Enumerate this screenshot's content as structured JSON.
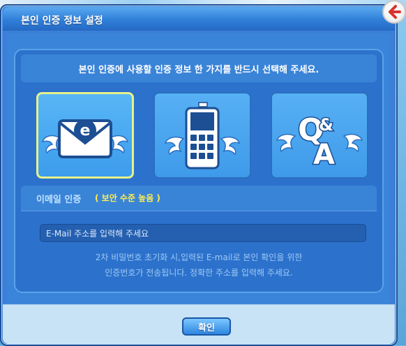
{
  "dialog": {
    "title": "본인 인증 정보 설정",
    "header_text": "본인 인증에 사용할 인증 정보 한 가지를 반드시 선택해 주세요.",
    "options": [
      {
        "icon": "winged-envelope-icon",
        "selected": true
      },
      {
        "icon": "winged-phone-icon",
        "selected": false
      },
      {
        "icon": "winged-qa-icon",
        "selected": false
      }
    ],
    "section": {
      "title": "이메일 인증",
      "note": "( 보안 수준 높음 )"
    },
    "email_input": {
      "value": "E-Mail 주소를 입력해 주세요"
    },
    "info_lines": [
      "2차 비밀번호 초기화 시,입력된 E-mail로 본인 확인을 위한",
      "인증번호가 전송됩니다. 정확한 주소를 입력해 주세요."
    ],
    "confirm_label": "확인"
  },
  "colors": {
    "panel": "#2c72cc",
    "accent_yellow": "#ffef52",
    "selected_border": "#e6f28a"
  }
}
